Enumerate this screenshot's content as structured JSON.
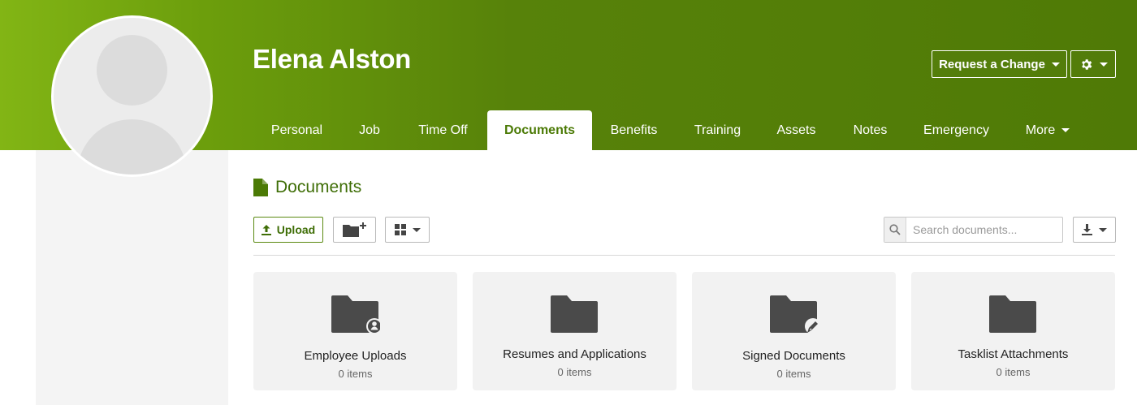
{
  "employee": {
    "name": "Elena Alston"
  },
  "header_actions": {
    "request_change_label": "Request a Change"
  },
  "tabs": [
    {
      "label": "Personal"
    },
    {
      "label": "Job"
    },
    {
      "label": "Time Off"
    },
    {
      "label": "Documents",
      "active": true
    },
    {
      "label": "Benefits"
    },
    {
      "label": "Training"
    },
    {
      "label": "Assets"
    },
    {
      "label": "Notes"
    },
    {
      "label": "Emergency"
    },
    {
      "label": "More"
    }
  ],
  "documents": {
    "title": "Documents",
    "upload_label": "Upload",
    "search_placeholder": "Search documents...",
    "folders": [
      {
        "name": "Employee Uploads",
        "count": "0 items",
        "icon": "folder-person-icon"
      },
      {
        "name": "Resumes and Applications",
        "count": "0 items",
        "icon": "folder-icon"
      },
      {
        "name": "Signed Documents",
        "count": "0 items",
        "icon": "folder-signed-icon"
      },
      {
        "name": "Tasklist Attachments",
        "count": "0 items",
        "icon": "folder-icon"
      }
    ]
  },
  "colors": {
    "brand": "#4f7a06",
    "brand_light": "#82b515",
    "accent_text": "#3f6e07"
  }
}
